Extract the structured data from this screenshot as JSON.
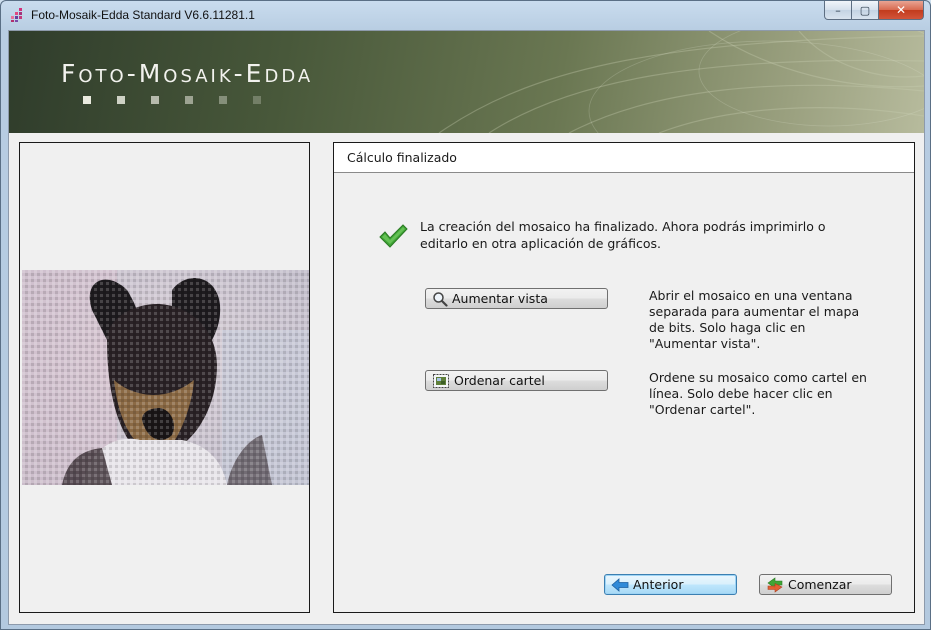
{
  "window": {
    "title": "Foto-Mosaik-Edda Standard V6.6.11281.1",
    "controls": {
      "minimize": "–",
      "maximize": "▢",
      "close": "✕"
    }
  },
  "banner": {
    "title": "Foto-Mosaik-Edda"
  },
  "panel": {
    "heading": "Cálculo finalizado",
    "message": "La creación del mosaico ha finalizado. Ahora podrás imprimirlo o editarlo en otra aplicación de gráficos."
  },
  "actions": [
    {
      "label": "Aumentar vista",
      "icon": "magnifier-icon",
      "description": "Abrir el mosaico en una ventana separada para aumentar el mapa de bits. Solo haga clic en \"Aumentar vista\"."
    },
    {
      "label": "Ordenar cartel",
      "icon": "poster-icon",
      "description": "Ordene su mosaico como cartel en línea. Solo debe hacer clic en \"Ordenar cartel\"."
    }
  ],
  "nav": {
    "back_label": "Anterior",
    "start_label": "Comenzar"
  },
  "colors": {
    "accent": "#3c7fb1",
    "check": "#3fa535",
    "banner": "#48583a"
  }
}
